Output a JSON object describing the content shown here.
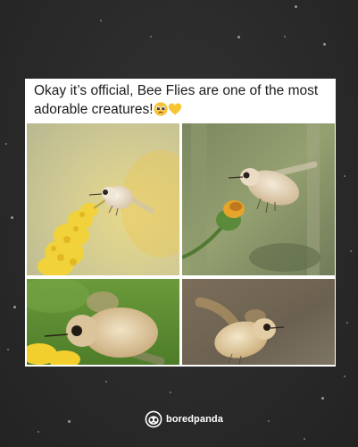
{
  "post": {
    "caption_line1": "Okay it’s official, Bee Flies are one of the most",
    "caption_line2": "adorable creatures!"
  },
  "emojis": [
    "pleading-face-emoji",
    "yellow-heart-emoji"
  ],
  "photos": [
    {
      "subject": "bee-fly-over-goldenrod"
    },
    {
      "subject": "bee-fly-over-flower-bud"
    },
    {
      "subject": "bee-fly-closeup-on-yellow-flowers"
    },
    {
      "subject": "bee-fly-hovering"
    }
  ],
  "branding": {
    "name": "boredpanda",
    "icon": "panda-logo-icon"
  },
  "colors": {
    "background": "#2b2b2b",
    "card": "#ffffff",
    "brand_text": "#ffffff"
  }
}
